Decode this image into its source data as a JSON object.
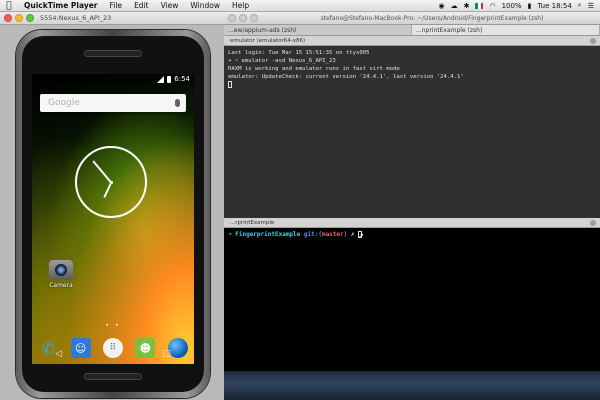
{
  "menubar": {
    "apple": "",
    "app_name": "QuickTime Player",
    "menus": [
      "File",
      "Edit",
      "View",
      "Window",
      "Help"
    ],
    "status": {
      "battery": "100%",
      "clock": "Tue 18:54"
    }
  },
  "qt_window": {
    "title": "5554:Nexus_6_API_23"
  },
  "phone": {
    "status_time": "6:54",
    "search_placeholder": "Google",
    "camera_label": "Camera",
    "page_dots": "• •"
  },
  "terminal": {
    "title": "stefano@Stefano-MacBook-Pro: ~/Users/Android/FingerprintExample (zsh)",
    "tabs": [
      "...ew/appium-ads (zsh)",
      "...nprintExample (zsh)"
    ],
    "pane1_header": "emulator (emulator64-x86)",
    "pane1_lines": [
      "Last login: Tue Mar 15 15:51:35 on ttys005",
      "➜ ~ emulator -avd Nexus_6_API_23",
      "HAXM is working and emulator runs in fast virt mode",
      "emulator: UpdateCheck: current version '24.4.1', last version '24.4.1'"
    ],
    "pane2_header": "...rprintExample",
    "prompt": {
      "arrow": "➜",
      "dir": "FingerprintExample",
      "git": "git:(",
      "branch": "master",
      "git_close": ")",
      "mark": "✗"
    }
  }
}
